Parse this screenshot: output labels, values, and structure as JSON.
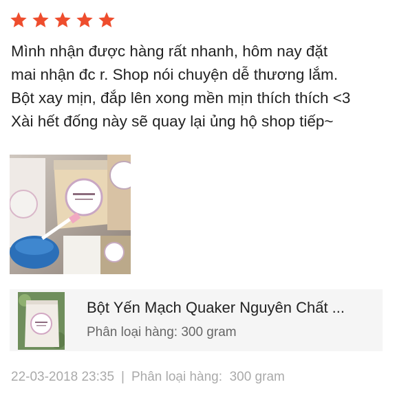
{
  "rating": {
    "stars": 5,
    "max": 5,
    "color": "#ee4d2d"
  },
  "review": {
    "lines": [
      "Mình nhận được hàng rất nhanh, hôm nay đặt",
      "mai nhận đc r. Shop nói chuyện dễ thương lắm.",
      "Bột xay mịn, đắp lên xong mền mịn thích thích <3",
      "Xài hết đống này sẽ quay lại ủng hộ shop tiếp~"
    ]
  },
  "photo": {
    "icon": "product-photo"
  },
  "product": {
    "name": "Bột Yến Mạch Quaker Nguyên Chất ...",
    "variant": "Phân loại hàng: 300 gram"
  },
  "meta": {
    "date": "22-03-2018 23:35",
    "separator": "|",
    "variant_label": "Phân loại hàng:",
    "variant_value": "300 gram"
  }
}
